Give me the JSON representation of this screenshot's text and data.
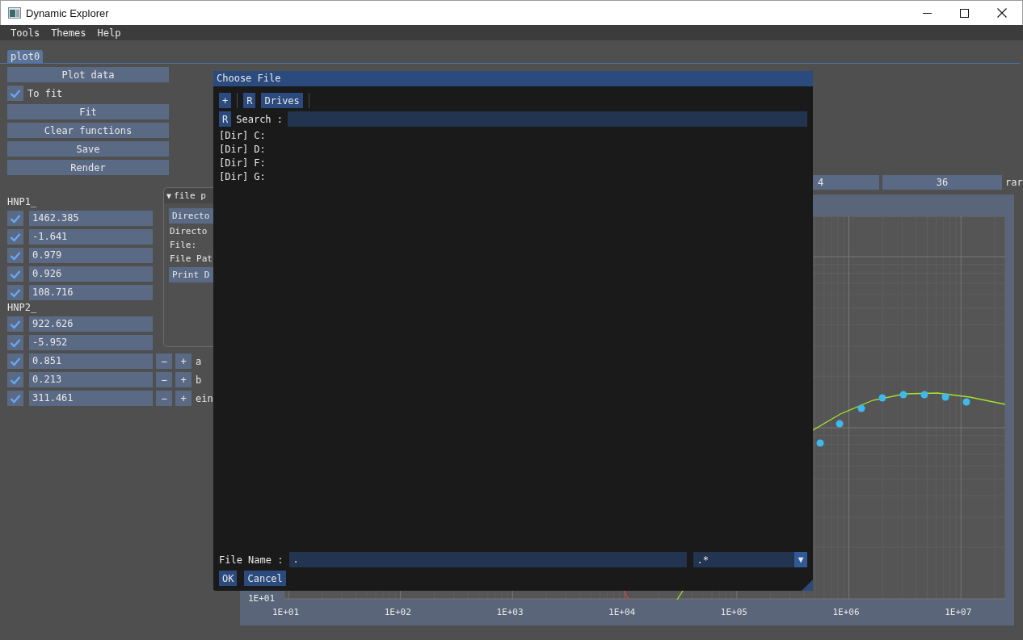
{
  "window": {
    "title": "Dynamic Explorer"
  },
  "menu": [
    "Tools",
    "Themes",
    "Help"
  ],
  "tabs": [
    {
      "label": "plot0",
      "selected": true
    }
  ],
  "actions": [
    {
      "kind": "button",
      "label": "Plot data"
    },
    {
      "kind": "checkbox",
      "label": "To fit",
      "checked": true
    },
    {
      "kind": "button",
      "label": "Fit"
    },
    {
      "kind": "button",
      "label": "Clear functions"
    },
    {
      "kind": "button",
      "label": "Save"
    },
    {
      "kind": "button",
      "label": "Render"
    }
  ],
  "groups": [
    {
      "title": "HNP1_",
      "params": [
        {
          "checked": true,
          "value": "1462.385"
        },
        {
          "checked": true,
          "value": "-1.641"
        },
        {
          "checked": true,
          "value": "0.979"
        },
        {
          "checked": true,
          "value": "0.926"
        },
        {
          "checked": true,
          "value": "108.716"
        }
      ]
    },
    {
      "title": "HNP2_",
      "params": [
        {
          "checked": true,
          "value": "922.626"
        },
        {
          "checked": true,
          "value": "-5.952"
        },
        {
          "checked": true,
          "value": "0.851",
          "minus": "−",
          "plus": "+",
          "label": "a"
        },
        {
          "checked": true,
          "value": "0.213",
          "minus": "−",
          "plus": "+",
          "label": "b"
        },
        {
          "checked": true,
          "value": "311.461",
          "minus": "−",
          "plus": "+",
          "label": "ein"
        }
      ]
    }
  ],
  "plot_controls": {
    "fields": [
      "4",
      "36"
    ],
    "trailing_label": "rar"
  },
  "plot": {
    "y_tick_labels": [
      "1E+01"
    ],
    "x_tick_labels": [
      "1E+01",
      "1E+02",
      "1E+03",
      "1E+04",
      "1E+05",
      "1E+06",
      "1E+07"
    ]
  },
  "file_picker": {
    "collapse_glyph": "▼",
    "title": "file p",
    "items": [
      {
        "kind": "button",
        "label": "Directo"
      },
      {
        "kind": "text",
        "label": "Directo"
      },
      {
        "kind": "text",
        "label": "File:"
      },
      {
        "kind": "text",
        "label": "File Pat"
      },
      {
        "kind": "button",
        "label": "Print D"
      }
    ]
  },
  "dialog": {
    "title": "Choose File",
    "toolbar": [
      {
        "kind": "button",
        "label": "+"
      },
      {
        "kind": "separator"
      },
      {
        "kind": "button",
        "label": "R"
      },
      {
        "kind": "button",
        "label": "Drives"
      },
      {
        "kind": "separator"
      }
    ],
    "search": {
      "reset": "R",
      "label": "Search :"
    },
    "entries": [
      "[Dir] C:",
      "[Dir] D:",
      "[Dir] F:",
      "[Dir] G:"
    ],
    "file_name": {
      "label": "File Name :",
      "value": "."
    },
    "filter": {
      "value": ".*",
      "arrow": "▼"
    },
    "buttons": [
      "OK",
      "Cancel"
    ]
  }
}
